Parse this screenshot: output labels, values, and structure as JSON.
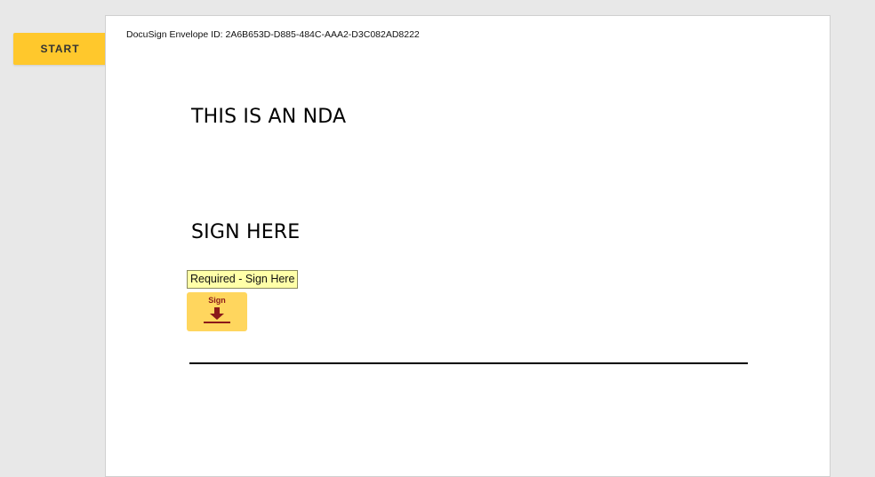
{
  "toolbar": {
    "start_label": "START"
  },
  "document": {
    "envelope_id": "DocuSign Envelope ID: 2A6B653D-D885-484C-AAA2-D3C082AD8222",
    "heading_nda": "THIS IS AN NDA",
    "heading_sign": "SIGN HERE"
  },
  "sign_field": {
    "tooltip": "Required - Sign Here",
    "tab_label": "Sign",
    "icon": "download-arrow-icon"
  },
  "colors": {
    "start_button": "#ffc82c",
    "sign_tab": "#ffd65e",
    "sign_icon": "#8b1a1a",
    "tooltip_bg": "#ffffa8",
    "canvas_bg": "#e8e8e8"
  }
}
